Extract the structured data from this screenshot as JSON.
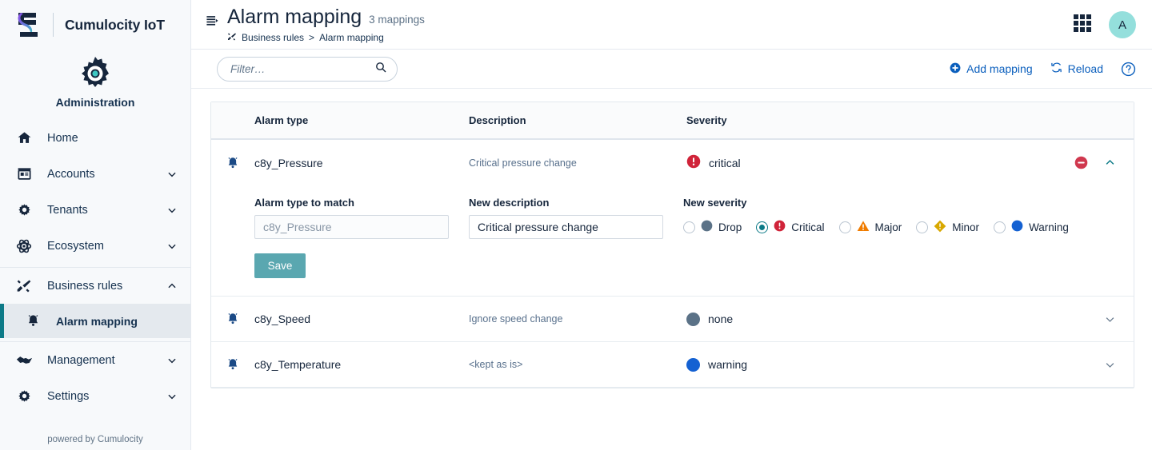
{
  "brand": {
    "name": "Cumulocity IoT",
    "logo_icon": "cumulocity-logo",
    "app_icon": "gear-icon",
    "app_label": "Administration",
    "powered_by": "powered by Cumulocity"
  },
  "sidebar": {
    "items": [
      {
        "label": "Home",
        "icon": "home-icon",
        "expandable": false,
        "active": false
      },
      {
        "label": "Accounts",
        "icon": "accounts-icon",
        "expandable": true,
        "active": false
      },
      {
        "label": "Tenants",
        "icon": "gear-icon",
        "expandable": true,
        "active": false
      },
      {
        "label": "Ecosystem",
        "icon": "ecosystem-icon",
        "expandable": true,
        "active": false
      },
      {
        "label": "Business rules",
        "icon": "business-rules-icon",
        "expandable": true,
        "expanded": true,
        "active": false
      },
      {
        "label": "Alarm mapping",
        "icon": "bell-icon",
        "sub": true,
        "active": true
      },
      {
        "label": "Management",
        "icon": "handshake-icon",
        "expandable": true,
        "active": false
      },
      {
        "label": "Settings",
        "icon": "gear-icon",
        "expandable": true,
        "active": false
      }
    ]
  },
  "header": {
    "collapse_icon": "collapse-sidebar-icon",
    "title": "Alarm mapping",
    "count": "3 mappings",
    "breadcrumb_icon": "business-rules-icon",
    "breadcrumb": [
      "Business rules",
      "Alarm mapping"
    ],
    "breadcrumb_separator": ">",
    "apps_icon": "app-switcher-icon",
    "avatar_initial": "A"
  },
  "toolbar": {
    "filter_placeholder": "Filter…",
    "filter_value": "",
    "search_icon": "search-icon",
    "add_mapping_label": "Add mapping",
    "add_mapping_icon": "plus-circle-icon",
    "reload_label": "Reload",
    "reload_icon": "reload-icon",
    "help_icon": "help-circle-icon"
  },
  "table": {
    "columns": {
      "alarm_type": "Alarm type",
      "description": "Description",
      "severity": "Severity"
    },
    "rows": [
      {
        "icon": "bell-icon",
        "alarm_type": "c8y_Pressure",
        "description": "Critical pressure change",
        "severity": "critical",
        "severity_icon": "critical-icon",
        "expanded": true,
        "remove_icon": "remove-circle-icon",
        "toggle_icon": "chevron-up-icon"
      },
      {
        "icon": "bell-icon",
        "alarm_type": "c8y_Speed",
        "description": "Ignore speed change",
        "severity": "none",
        "severity_icon": "none-dot-icon",
        "expanded": false,
        "toggle_icon": "chevron-down-icon"
      },
      {
        "icon": "bell-icon",
        "alarm_type": "c8y_Temperature",
        "description": "<kept as is>",
        "severity": "warning",
        "severity_icon": "warning-dot-icon",
        "expanded": false,
        "toggle_icon": "chevron-down-icon"
      }
    ]
  },
  "edit_form": {
    "alarm_type_label": "Alarm type to match",
    "alarm_type_value": "",
    "alarm_type_placeholder": "c8y_Pressure",
    "description_label": "New description",
    "description_value": "Critical pressure change",
    "severity_label": "New severity",
    "severity_options": [
      {
        "label": "Drop",
        "icon": "drop-dot-icon",
        "selected": false
      },
      {
        "label": "Critical",
        "icon": "critical-icon",
        "selected": true
      },
      {
        "label": "Major",
        "icon": "major-triangle-icon",
        "selected": false
      },
      {
        "label": "Minor",
        "icon": "minor-diamond-icon",
        "selected": false
      },
      {
        "label": "Warning",
        "icon": "warning-dot-icon",
        "selected": false
      }
    ],
    "save_label": "Save"
  },
  "colors": {
    "accent_teal": "#0c7a87",
    "critical_red": "#d02339",
    "major_orange": "#f07c00",
    "minor_gold": "#d8a800",
    "warning_blue": "#1461d2",
    "drop_gray": "#5b7287",
    "link_blue": "#0b5fbd",
    "save_teal": "#5aa7b0",
    "avatar_teal": "#94dfdc",
    "sidebar_bg": "#f7f9fb"
  }
}
